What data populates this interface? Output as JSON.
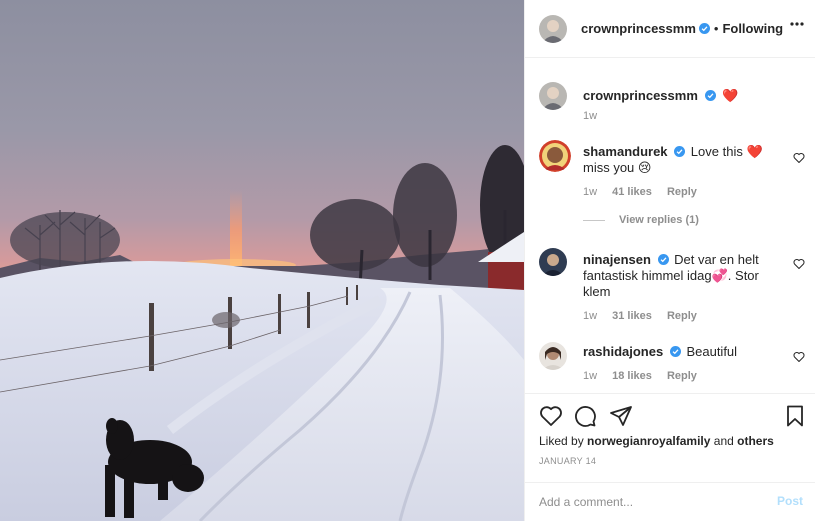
{
  "colors": {
    "accent": "#0095f6",
    "verified": "#3897f0",
    "muted": "#8e8e8e",
    "post_disabled": "#b2dffc",
    "heart_red": "#ed4956"
  },
  "post": {
    "author": "crownprincessmm",
    "follow_status": "Following",
    "separator": "•"
  },
  "caption": {
    "username": "crownprincessmm",
    "text": "❤️",
    "time": "1w"
  },
  "comments": [
    {
      "username": "shamandurek",
      "text": "Love this ❤️miss you 😢",
      "time": "1w",
      "likes": "41 likes",
      "reply": "Reply",
      "view_replies": "View replies (1)"
    },
    {
      "username": "ninajensen",
      "text": "Det var en helt fantastisk himmel idag💞. Stor klem",
      "time": "1w",
      "likes": "31 likes",
      "reply": "Reply"
    },
    {
      "username": "rashidajones",
      "text": "Beautiful",
      "time": "1w",
      "likes": "18 likes",
      "reply": "Reply"
    }
  ],
  "actions": {
    "icons": [
      "heart-icon",
      "comment-icon",
      "share-icon",
      "bookmark-icon"
    ]
  },
  "likes": {
    "prefix": "Liked by",
    "user": "norwegianroyalfamily",
    "conj": "and",
    "others": "others"
  },
  "date": "JANUARY 14",
  "composer": {
    "placeholder": "Add a comment...",
    "post_label": "Post"
  }
}
